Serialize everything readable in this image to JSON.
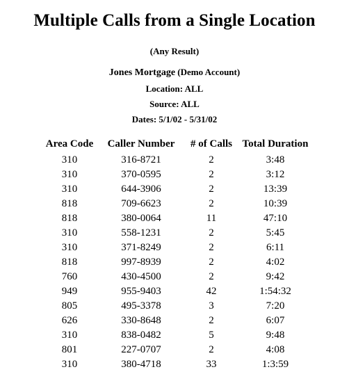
{
  "report": {
    "title": "Multiple Calls from a Single Location",
    "result_filter": "(Any Result)",
    "account_name": "Jones Mortgage",
    "account_type": "(Demo Account)",
    "location_line": "Location: ALL",
    "source_line": "Source: ALL",
    "dates_line": "Dates: 5/1/02 - 5/31/02",
    "text_color": "#000000",
    "background_color": "#ffffff"
  },
  "table": {
    "columns": [
      {
        "key": "area_code",
        "label": "Area Code"
      },
      {
        "key": "caller_number",
        "label": "Caller Number"
      },
      {
        "key": "num_calls",
        "label": "# of Calls"
      },
      {
        "key": "total_duration",
        "label": "Total Duration"
      }
    ],
    "rows": [
      {
        "area_code": "310",
        "caller_number": "316-8721",
        "num_calls": "2",
        "total_duration": "3:48"
      },
      {
        "area_code": "310",
        "caller_number": "370-0595",
        "num_calls": "2",
        "total_duration": "3:12"
      },
      {
        "area_code": "310",
        "caller_number": "644-3906",
        "num_calls": "2",
        "total_duration": "13:39"
      },
      {
        "area_code": "818",
        "caller_number": "709-6623",
        "num_calls": "2",
        "total_duration": "10:39"
      },
      {
        "area_code": "818",
        "caller_number": "380-0064",
        "num_calls": "11",
        "total_duration": "47:10"
      },
      {
        "area_code": "310",
        "caller_number": "558-1231",
        "num_calls": "2",
        "total_duration": "5:45"
      },
      {
        "area_code": "310",
        "caller_number": "371-8249",
        "num_calls": "2",
        "total_duration": "6:11"
      },
      {
        "area_code": "818",
        "caller_number": "997-8939",
        "num_calls": "2",
        "total_duration": "4:02"
      },
      {
        "area_code": "760",
        "caller_number": "430-4500",
        "num_calls": "2",
        "total_duration": "9:42"
      },
      {
        "area_code": "949",
        "caller_number": "955-9403",
        "num_calls": "42",
        "total_duration": "1:54:32"
      },
      {
        "area_code": "805",
        "caller_number": "495-3378",
        "num_calls": "3",
        "total_duration": "7:20"
      },
      {
        "area_code": "626",
        "caller_number": "330-8648",
        "num_calls": "2",
        "total_duration": "6:07"
      },
      {
        "area_code": "310",
        "caller_number": "838-0482",
        "num_calls": "5",
        "total_duration": "9:48"
      },
      {
        "area_code": "801",
        "caller_number": "227-0707",
        "num_calls": "2",
        "total_duration": "4:08"
      },
      {
        "area_code": "310",
        "caller_number": "380-4718",
        "num_calls": "33",
        "total_duration": "1:3:59"
      }
    ]
  }
}
